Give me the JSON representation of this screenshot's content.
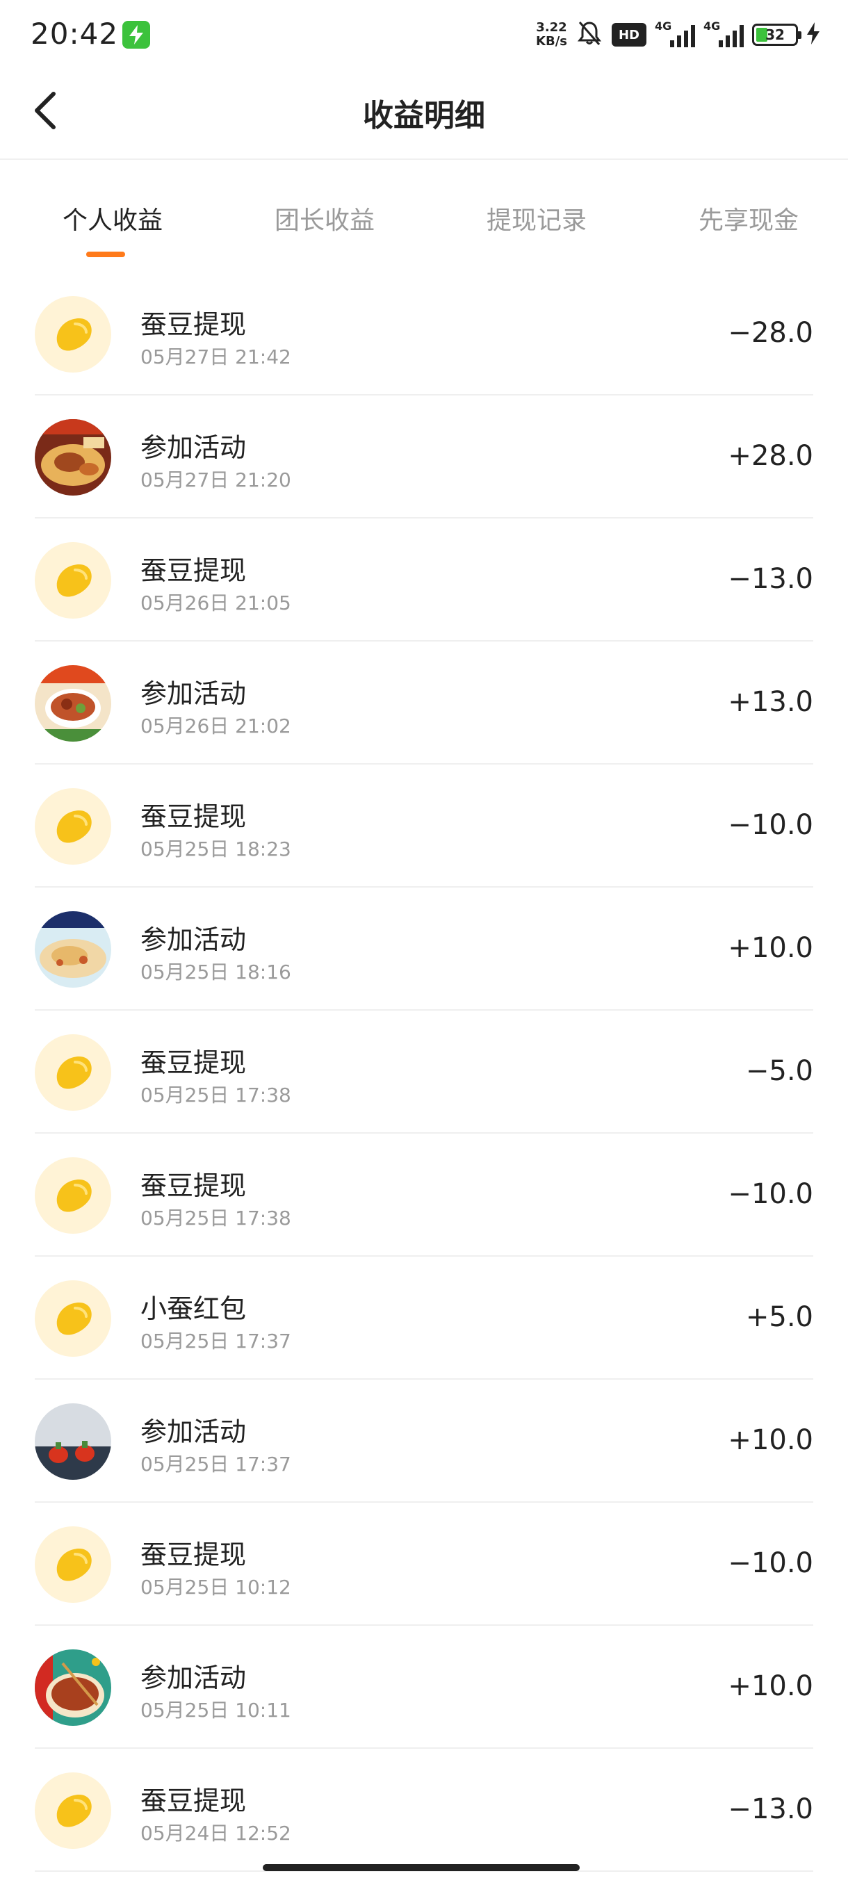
{
  "status_bar": {
    "time": "20:42",
    "net_speed_value": "3.22",
    "net_speed_unit": "KB/s",
    "hd_label": "HD",
    "network_1": "4G",
    "network_2": "4G",
    "battery": "32"
  },
  "header": {
    "title": "收益明细"
  },
  "tabs": [
    {
      "label": "个人收益",
      "active": true
    },
    {
      "label": "团长收益",
      "active": false
    },
    {
      "label": "提现记录",
      "active": false
    },
    {
      "label": "先享现金",
      "active": false
    }
  ],
  "accent_color": "#ff7a1a",
  "records": [
    {
      "icon": "bean-icon",
      "title": "蚕豆提现",
      "time": "05月27日 21:42",
      "amount": "−28.0"
    },
    {
      "icon": "activity-thumbnail",
      "title": "参加活动",
      "time": "05月27日 21:20",
      "amount": "+28.0"
    },
    {
      "icon": "bean-icon",
      "title": "蚕豆提现",
      "time": "05月26日 21:05",
      "amount": "−13.0"
    },
    {
      "icon": "activity-thumbnail",
      "title": "参加活动",
      "time": "05月26日 21:02",
      "amount": "+13.0"
    },
    {
      "icon": "bean-icon",
      "title": "蚕豆提现",
      "time": "05月25日 18:23",
      "amount": "−10.0"
    },
    {
      "icon": "activity-thumbnail",
      "title": "参加活动",
      "time": "05月25日 18:16",
      "amount": "+10.0"
    },
    {
      "icon": "bean-icon",
      "title": "蚕豆提现",
      "time": "05月25日 17:38",
      "amount": "−5.0"
    },
    {
      "icon": "bean-icon",
      "title": "蚕豆提现",
      "time": "05月25日 17:38",
      "amount": "−10.0"
    },
    {
      "icon": "bean-icon",
      "title": "小蚕红包",
      "time": "05月25日 17:37",
      "amount": "+5.0"
    },
    {
      "icon": "activity-thumbnail",
      "title": "参加活动",
      "time": "05月25日 17:37",
      "amount": "+10.0"
    },
    {
      "icon": "bean-icon",
      "title": "蚕豆提现",
      "time": "05月25日 10:12",
      "amount": "−10.0"
    },
    {
      "icon": "activity-thumbnail",
      "title": "参加活动",
      "time": "05月25日 10:11",
      "amount": "+10.0"
    },
    {
      "icon": "bean-icon",
      "title": "蚕豆提现",
      "time": "05月24日 12:52",
      "amount": "−13.0"
    }
  ]
}
